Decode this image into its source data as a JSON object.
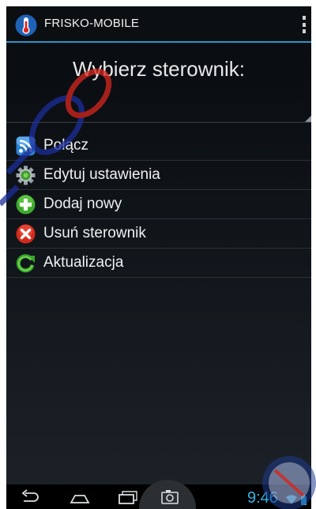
{
  "app": {
    "title": "FRISKO-MOBILE"
  },
  "heading": "Wybierz sterownik:",
  "menu": {
    "items": [
      {
        "label": "Połącz",
        "icon": "rss-icon"
      },
      {
        "label": "Edytuj ustawienia",
        "icon": "gear-icon"
      },
      {
        "label": "Dodaj nowy",
        "icon": "plus-icon"
      },
      {
        "label": "Usuń sterownik",
        "icon": "delete-icon"
      },
      {
        "label": "Aktualizacja",
        "icon": "refresh-icon"
      }
    ]
  },
  "status": {
    "time": "9:46"
  },
  "colors": {
    "accent": "#33b5e5",
    "actionbar_border": "#2a94c8",
    "background": "#10151a"
  }
}
